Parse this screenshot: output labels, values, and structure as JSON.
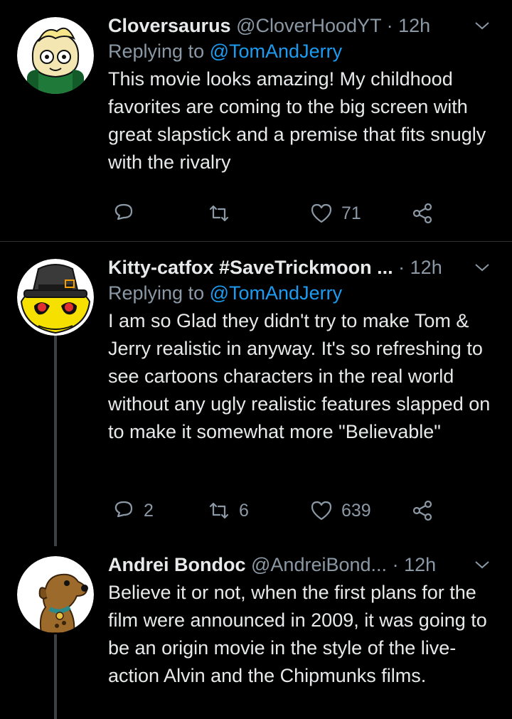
{
  "tweets": [
    {
      "name": "Cloversaurus",
      "handle": "@CloverHoodYT",
      "dot": "·",
      "time": "12h",
      "replying_prefix": "Replying to",
      "replying_to": "@TomAndJerry",
      "text": "This movie looks amazing! My childhood favorites are coming to the big screen with great slapstick and a premise that fits snugly with the rivalry",
      "actions": {
        "reply_count": "",
        "retweet_count": "",
        "like_count": "71"
      },
      "avatar_color": "#1f7a3a"
    },
    {
      "name": "Kitty-catfox #SaveTrickmoon ...",
      "handle": "",
      "dot": "·",
      "time": "12h",
      "replying_prefix": "Replying to",
      "replying_to": "@TomAndJerry",
      "text": "I am so Glad they didn't try to make Tom & Jerry realistic in anyway. It's so refreshing to see cartoons characters in the real world without any ugly realistic features slapped on to make it somewhat more \"Believable\"",
      "actions": {
        "reply_count": "2",
        "retweet_count": "6",
        "like_count": "639"
      },
      "avatar_color": "#f5e000"
    },
    {
      "name": "Andrei Bondoc",
      "handle": "@AndreiBond...",
      "dot": "·",
      "time": "12h",
      "text": "Believe it or not, when the first plans for the film were announced in 2009, it was going to be an origin movie in the style of the live-action Alvin and the Chipmunks films.",
      "avatar_color": "#ffffff"
    }
  ],
  "colors": {
    "background": "#000000",
    "muted": "#8b98a5",
    "link": "#1d9bf0",
    "divider": "#2f3336"
  }
}
